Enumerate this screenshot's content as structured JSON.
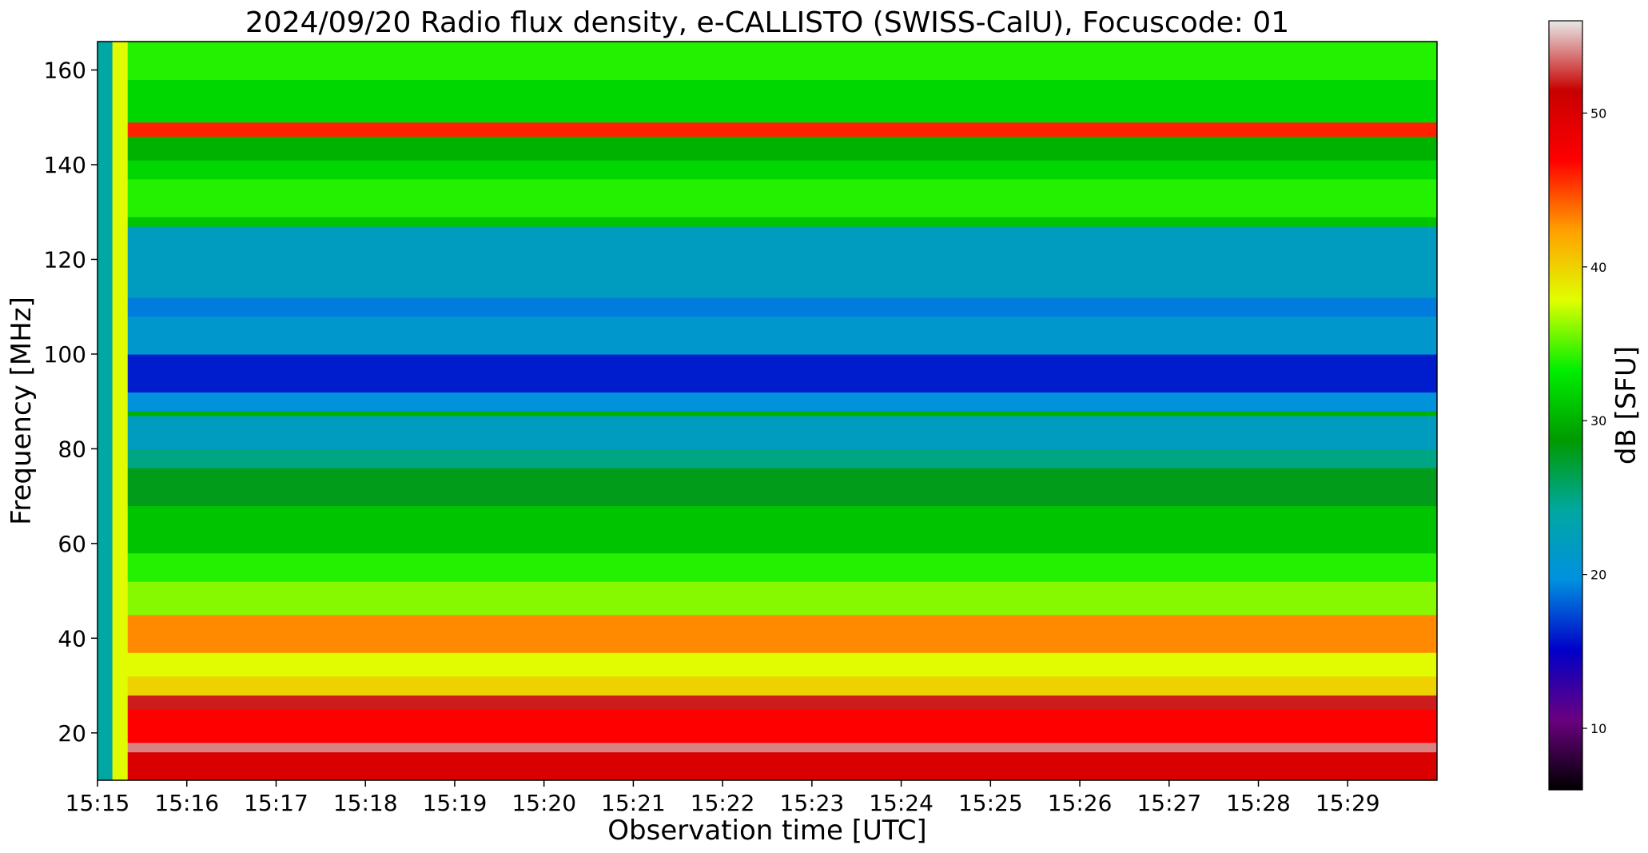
{
  "chart_data": {
    "type": "heatmap",
    "title": "2024/09/20  Radio flux density, e-CALLISTO (SWISS-CalU), Focuscode: 01",
    "xlabel": "Observation time [UTC]",
    "ylabel": "Frequency [MHz]",
    "x_ticks": [
      "15:15",
      "15:16",
      "15:17",
      "15:18",
      "15:19",
      "15:20",
      "15:21",
      "15:22",
      "15:23",
      "15:24",
      "15:25",
      "15:26",
      "15:27",
      "15:28",
      "15:29"
    ],
    "xlim": [
      "15:15",
      "15:30"
    ],
    "y_ticks": [
      20,
      40,
      60,
      80,
      100,
      120,
      140,
      160
    ],
    "ylim": [
      10,
      166
    ],
    "colorbar": {
      "label": "dB [SFU]",
      "ticks": [
        10,
        20,
        30,
        40,
        50
      ],
      "range": [
        6,
        56
      ],
      "colors": [
        "#000000",
        "#6a0080",
        "#0000c8",
        "#0090e0",
        "#00a8a0",
        "#009a00",
        "#00ee00",
        "#e0ff00",
        "#ffa000",
        "#ff0000",
        "#c80000",
        "#e8e8e8"
      ]
    },
    "bands": [
      {
        "fmin": 10,
        "fmax": 16,
        "db": 50
      },
      {
        "fmin": 16,
        "fmax": 18,
        "db": 54
      },
      {
        "fmin": 18,
        "fmax": 25,
        "db": 47
      },
      {
        "fmin": 25,
        "fmax": 28,
        "db": 52
      },
      {
        "fmin": 28,
        "fmax": 32,
        "db": 40
      },
      {
        "fmin": 32,
        "fmax": 37,
        "db": 38
      },
      {
        "fmin": 37,
        "fmax": 45,
        "db": 43
      },
      {
        "fmin": 45,
        "fmax": 52,
        "db": 36
      },
      {
        "fmin": 52,
        "fmax": 58,
        "db": 34
      },
      {
        "fmin": 58,
        "fmax": 68,
        "db": 31
      },
      {
        "fmin": 68,
        "fmax": 76,
        "db": 28
      },
      {
        "fmin": 76,
        "fmax": 80,
        "db": 25
      },
      {
        "fmin": 80,
        "fmax": 87,
        "db": 22
      },
      {
        "fmin": 87,
        "fmax": 88,
        "db": 30
      },
      {
        "fmin": 88,
        "fmax": 92,
        "db": 20
      },
      {
        "fmin": 92,
        "fmax": 100,
        "db": 16
      },
      {
        "fmin": 100,
        "fmax": 108,
        "db": 21
      },
      {
        "fmin": 108,
        "fmax": 112,
        "db": 19
      },
      {
        "fmin": 112,
        "fmax": 127,
        "db": 22
      },
      {
        "fmin": 127,
        "fmax": 129,
        "db": 31
      },
      {
        "fmin": 129,
        "fmax": 137,
        "db": 34
      },
      {
        "fmin": 137,
        "fmax": 141,
        "db": 32
      },
      {
        "fmin": 141,
        "fmax": 146,
        "db": 30
      },
      {
        "fmin": 146,
        "fmax": 149,
        "db": 46
      },
      {
        "fmin": 149,
        "fmax": 158,
        "db": 32
      },
      {
        "fmin": 158,
        "fmax": 166,
        "db": 34
      }
    ],
    "leading_strips": [
      {
        "t_start": "15:15:00",
        "t_end": "15:15:10",
        "db": 24
      },
      {
        "t_start": "15:15:10",
        "t_end": "15:15:20",
        "db": 38
      }
    ]
  }
}
